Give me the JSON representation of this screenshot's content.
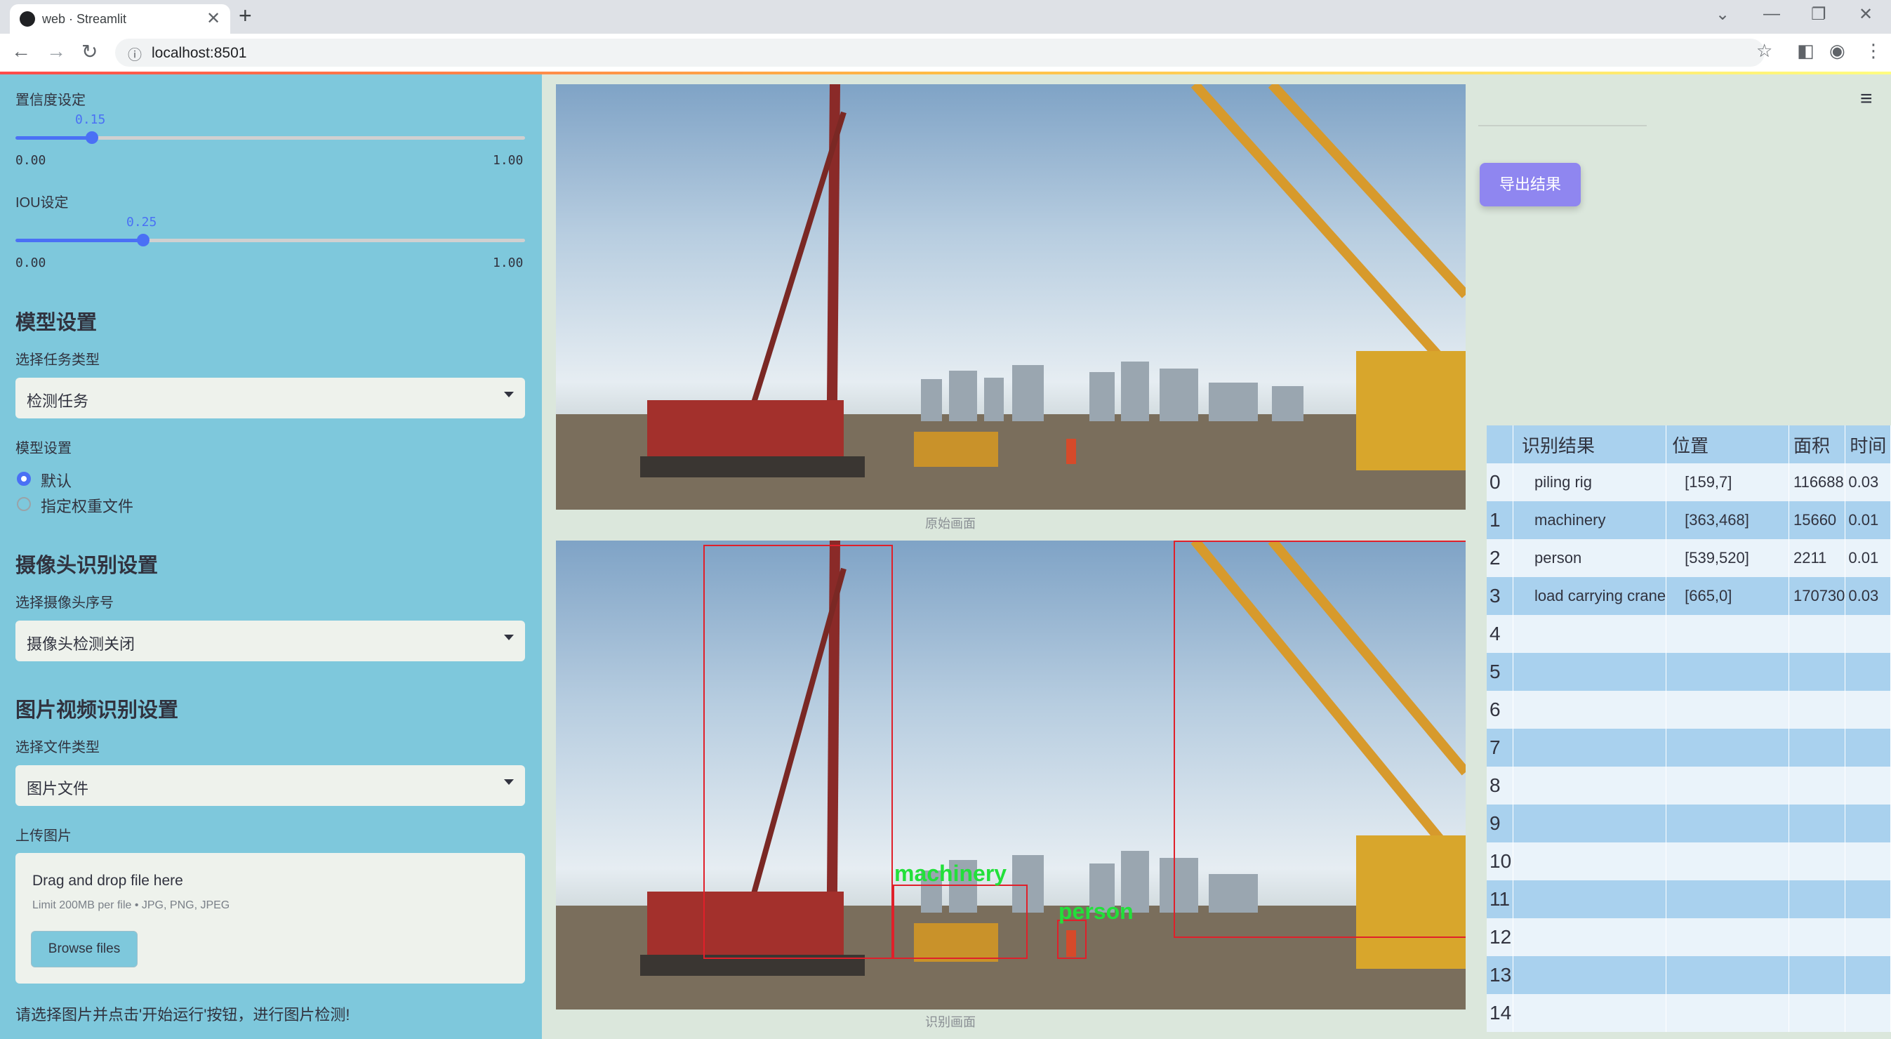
{
  "browser": {
    "tab_title": "web · Streamlit",
    "url": "localhost:8501"
  },
  "sidebar": {
    "confidence": {
      "label": "置信度设定",
      "value": "0.15",
      "min": "0.00",
      "max": "1.00",
      "fraction": 0.15
    },
    "iou": {
      "label": "IOU设定",
      "value": "0.25",
      "min": "0.00",
      "max": "1.00",
      "fraction": 0.25
    },
    "model_section": {
      "heading": "模型设置",
      "task_label": "选择任务类型",
      "task_value": "检测任务",
      "weights_label": "模型设置",
      "radio_default": "默认",
      "radio_custom": "指定权重文件"
    },
    "camera_section": {
      "heading": "摄像头识别设置",
      "label": "选择摄像头序号",
      "value": "摄像头检测关闭"
    },
    "media_section": {
      "heading": "图片视频识别设置",
      "type_label": "选择文件类型",
      "type_value": "图片文件",
      "upload_label": "上传图片",
      "drag_text": "Drag and drop file here",
      "limit_text": "Limit 200MB per file • JPG, PNG, JPEG",
      "browse_label": "Browse files"
    },
    "hint": "请选择图片并点击'开始运行'按钮，进行图片检测!"
  },
  "main": {
    "original_caption": "原始画面",
    "result_caption": "识别画面",
    "export_label": "导出结果",
    "detections": {
      "piling_label": "piling rig",
      "machinery_label": "machinery",
      "person_label": "person"
    },
    "table": {
      "headers": [
        "",
        "识别结果",
        "位置",
        "面积",
        "时间"
      ],
      "rows": [
        {
          "idx": "0",
          "name": "piling rig",
          "pos": "[159,7]",
          "area": "116688",
          "time": "0.03"
        },
        {
          "idx": "1",
          "name": "machinery",
          "pos": "[363,468]",
          "area": "15660",
          "time": "0.01"
        },
        {
          "idx": "2",
          "name": "person",
          "pos": "[539,520]",
          "area": "2211",
          "time": "0.01"
        },
        {
          "idx": "3",
          "name": "load carrying crane",
          "pos": "[665,0]",
          "area": "170730",
          "time": "0.03"
        },
        {
          "idx": "4"
        },
        {
          "idx": "5"
        },
        {
          "idx": "6"
        },
        {
          "idx": "7"
        },
        {
          "idx": "8"
        },
        {
          "idx": "9"
        },
        {
          "idx": "10"
        },
        {
          "idx": "11"
        },
        {
          "idx": "12"
        },
        {
          "idx": "13"
        },
        {
          "idx": "14"
        }
      ]
    }
  }
}
